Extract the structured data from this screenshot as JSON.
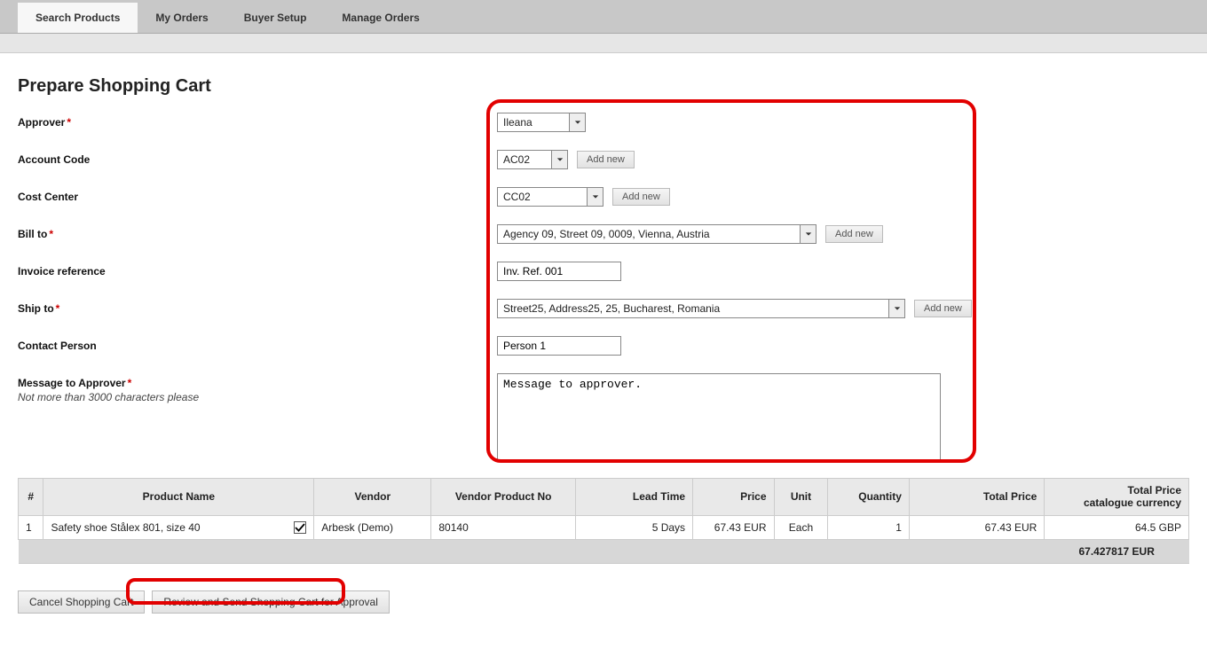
{
  "tabs": [
    "Search Products",
    "My Orders",
    "Buyer Setup",
    "Manage Orders"
  ],
  "activeTab": 0,
  "pageTitle": "Prepare Shopping Cart",
  "form": {
    "approver": {
      "label": "Approver",
      "required": true,
      "value": "Ileana"
    },
    "accountCode": {
      "label": "Account Code",
      "value": "AC02",
      "addNew": "Add new"
    },
    "costCenter": {
      "label": "Cost Center",
      "value": "CC02",
      "addNew": "Add new"
    },
    "billTo": {
      "label": "Bill to",
      "required": true,
      "value": "Agency 09, Street 09, 0009, Vienna, Austria",
      "addNew": "Add new"
    },
    "invoiceRef": {
      "label": "Invoice reference",
      "value": "Inv. Ref. 001"
    },
    "shipTo": {
      "label": "Ship to",
      "required": true,
      "value": "Street25, Address25, 25, Bucharest, Romania",
      "addNew": "Add new"
    },
    "contactPerson": {
      "label": "Contact Person",
      "value": "Person 1"
    },
    "message": {
      "label": "Message to Approver",
      "required": true,
      "hint": "Not more than 3000 characters please",
      "value": "Message to approver."
    }
  },
  "table": {
    "headers": {
      "num": "#",
      "product": "Product Name",
      "vendor": "Vendor",
      "vpn": "Vendor Product No",
      "lead": "Lead Time",
      "price": "Price",
      "unit": "Unit",
      "qty": "Quantity",
      "totalPrice": "Total Price",
      "totalPriceCat1": "Total Price",
      "totalPriceCat2": "catalogue currency"
    },
    "rows": [
      {
        "num": "1",
        "product": "Safety shoe Stålex 801, size 40",
        "vendor": "Arbesk (Demo)",
        "vpn": "80140",
        "lead": "5 Days",
        "price": "67.43 EUR",
        "unit": "Each",
        "qty": "1",
        "totalPrice": "67.43 EUR",
        "totalPriceCat": "64.5 GBP",
        "checked": true
      }
    ],
    "grandTotal": "67.427817 EUR"
  },
  "actions": {
    "cancel": "Cancel Shopping Cart",
    "review": "Review and Send Shopping Cart for Approval"
  }
}
